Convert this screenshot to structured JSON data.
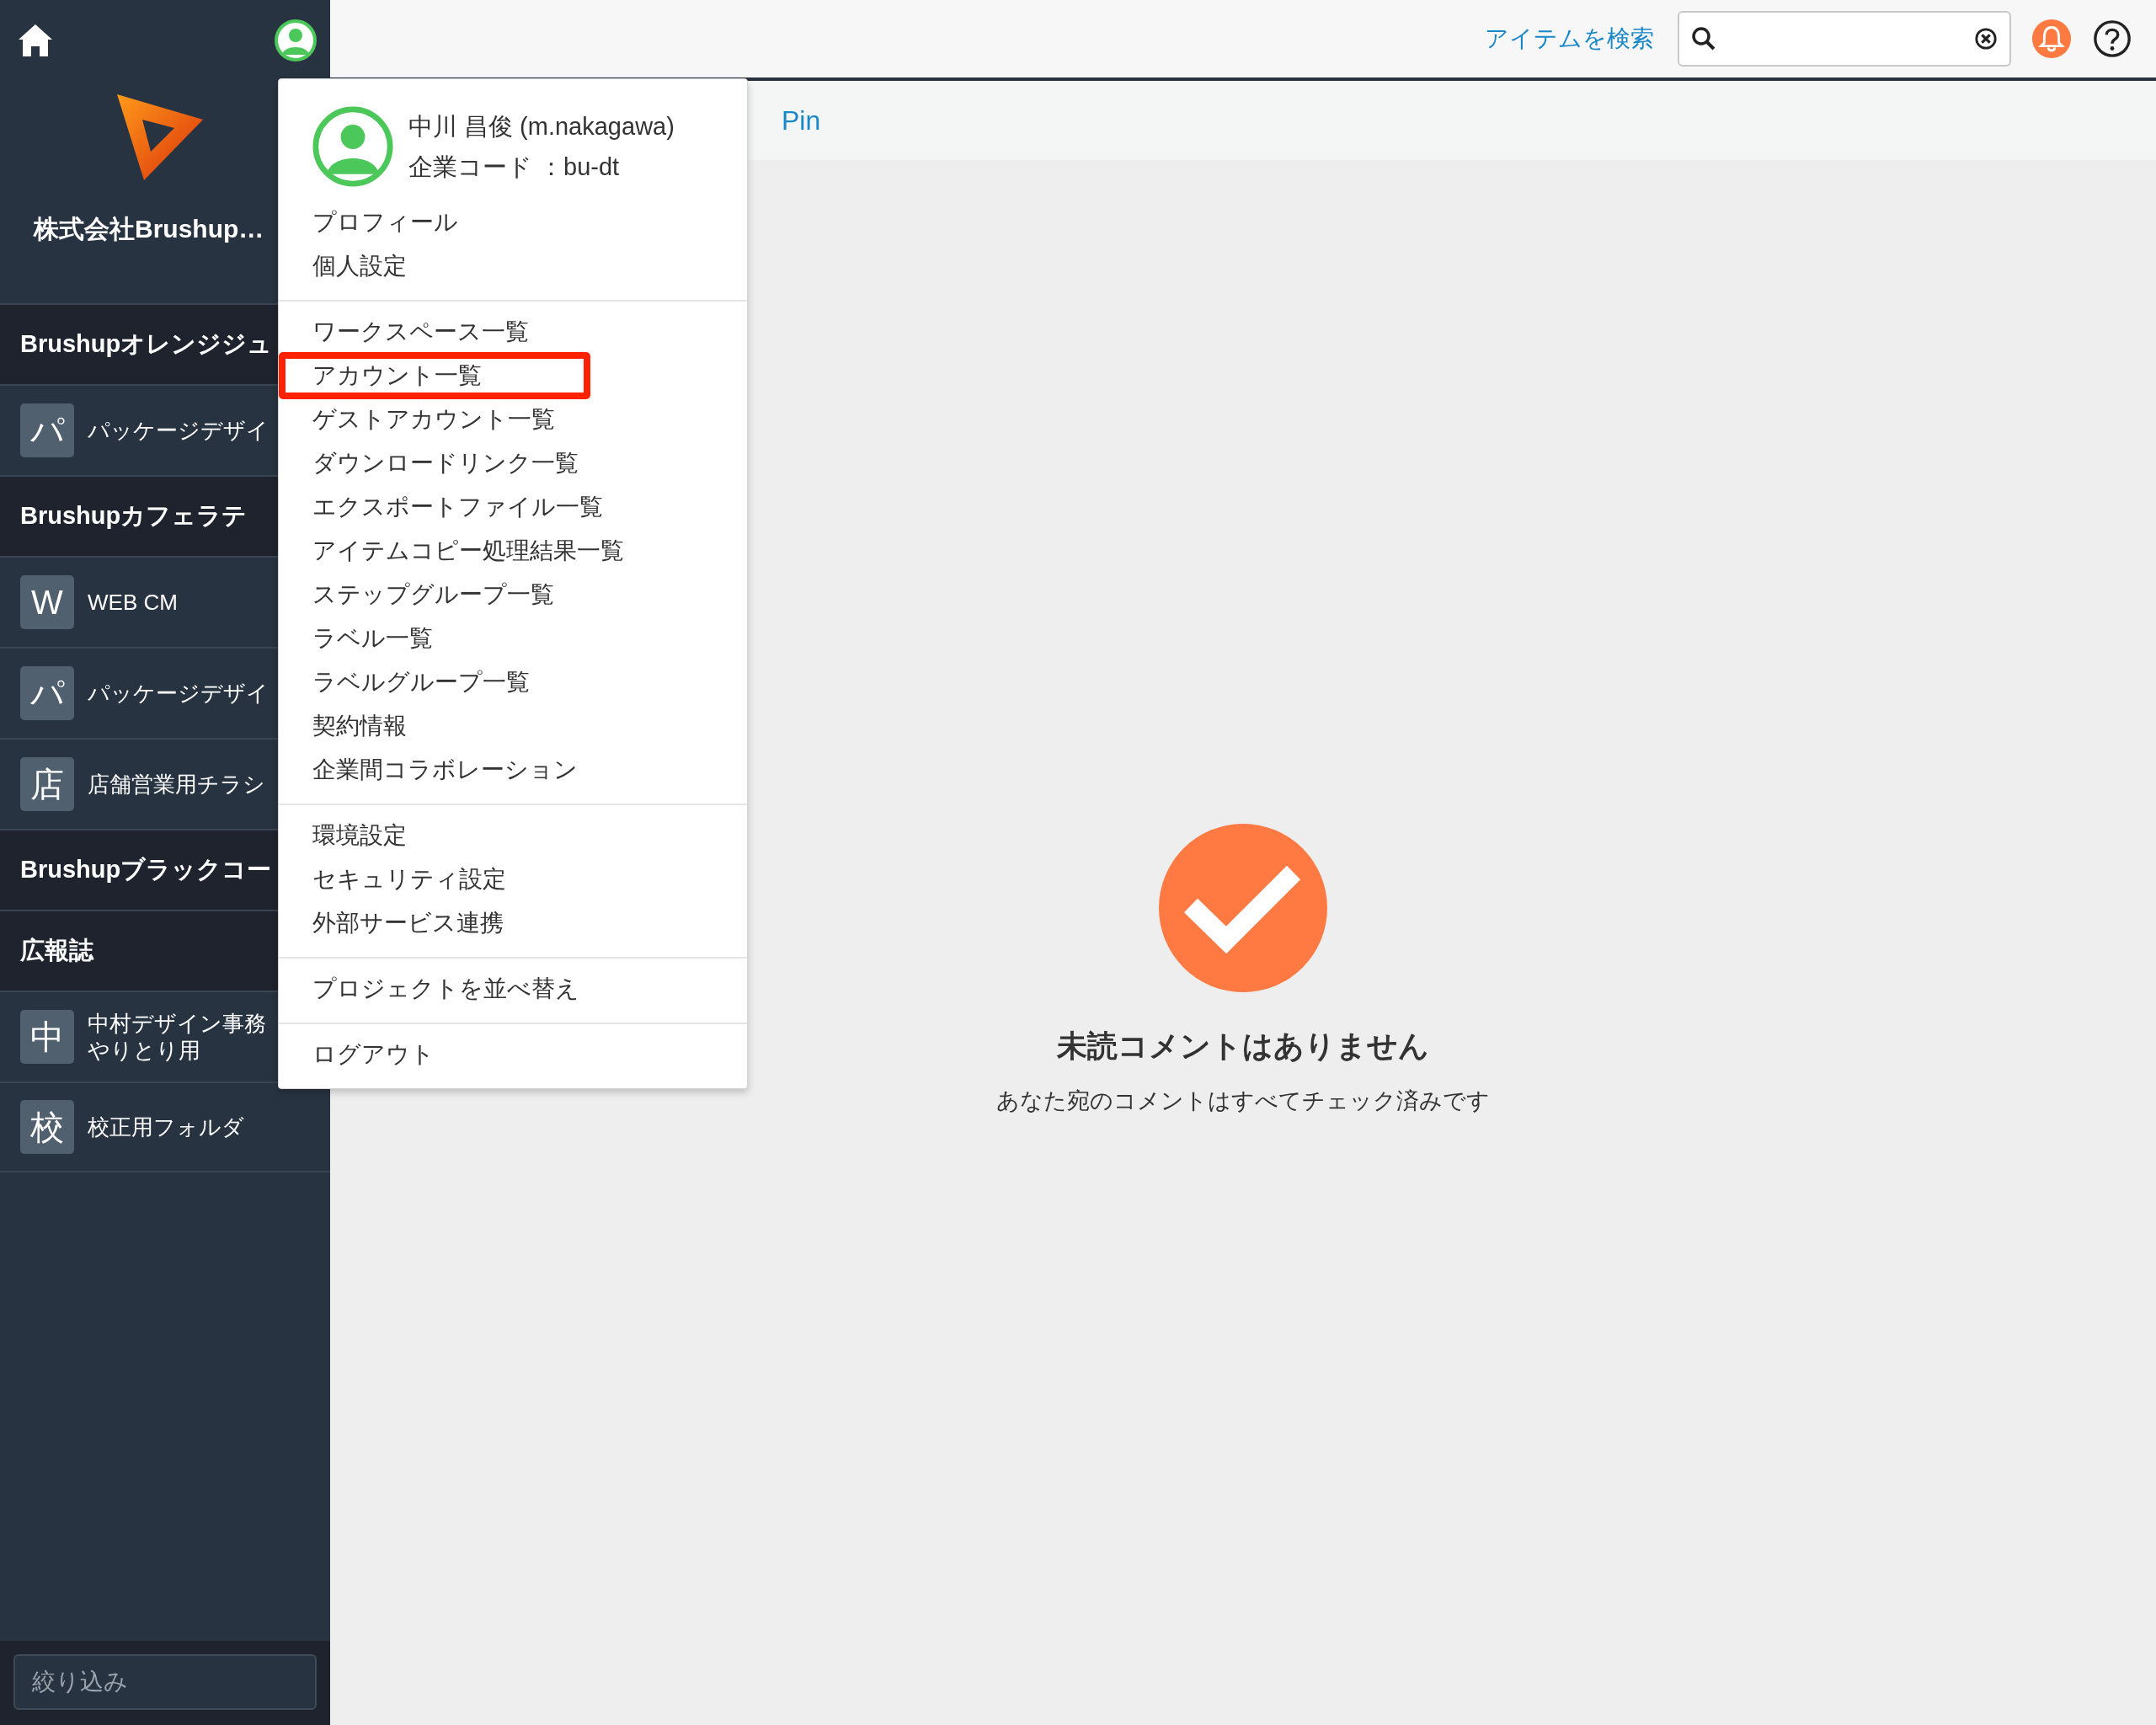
{
  "sidebar": {
    "company": "株式会社Brushup…",
    "items": [
      {
        "kind": "header",
        "label": "Brushupオレンジジュ"
      },
      {
        "kind": "project",
        "badge": "パ",
        "lines": [
          "パッケージデザイ"
        ]
      },
      {
        "kind": "header",
        "label": "Brushupカフェラテ"
      },
      {
        "kind": "project",
        "badge": "W",
        "lines": [
          "WEB CM"
        ]
      },
      {
        "kind": "project",
        "badge": "パ",
        "lines": [
          "パッケージデザイ"
        ]
      },
      {
        "kind": "project",
        "badge": "店",
        "lines": [
          "店舗営業用チラシ"
        ]
      },
      {
        "kind": "header",
        "label": "Brushupブラックコー"
      },
      {
        "kind": "header",
        "label": "広報誌"
      },
      {
        "kind": "project",
        "badge": "中",
        "lines": [
          "中村デザイン事務",
          "やりとり用"
        ]
      },
      {
        "kind": "project",
        "badge": "校",
        "lines": [
          "校正用フォルダ"
        ]
      }
    ],
    "filter": {
      "placeholder": "絞り込み"
    }
  },
  "topbar": {
    "search_label": "アイテムを検索"
  },
  "tab": {
    "label": "Pin"
  },
  "empty_state": {
    "title": "未読コメントはありません",
    "message": "あなた宛のコメントはすべてチェック済みです"
  },
  "user_menu": {
    "name": "中川 昌俊 (m.nakagawa)",
    "company_code": "企業コード ：bu-dt",
    "sections": [
      [
        {
          "label": "プロフィール",
          "highlighted": false
        },
        {
          "label": "個人設定",
          "highlighted": false
        }
      ],
      [
        {
          "label": "ワークスペース一覧",
          "highlighted": false
        },
        {
          "label": "アカウント一覧",
          "highlighted": true
        },
        {
          "label": "ゲストアカウント一覧",
          "highlighted": false
        },
        {
          "label": "ダウンロードリンク一覧",
          "highlighted": false
        },
        {
          "label": "エクスポートファイル一覧",
          "highlighted": false
        },
        {
          "label": "アイテムコピー処理結果一覧",
          "highlighted": false
        },
        {
          "label": "ステップグループ一覧",
          "highlighted": false
        },
        {
          "label": "ラベル一覧",
          "highlighted": false
        },
        {
          "label": "ラベルグループ一覧",
          "highlighted": false
        },
        {
          "label": "契約情報",
          "highlighted": false
        },
        {
          "label": "企業間コラボレーション",
          "highlighted": false
        }
      ],
      [
        {
          "label": "環境設定",
          "highlighted": false
        },
        {
          "label": "セキュリティ設定",
          "highlighted": false
        },
        {
          "label": "外部サービス連携",
          "highlighted": false
        }
      ],
      [
        {
          "label": "プロジェクトを並べ替え",
          "highlighted": false
        }
      ],
      [
        {
          "label": "ログアウト",
          "highlighted": false
        }
      ]
    ]
  }
}
